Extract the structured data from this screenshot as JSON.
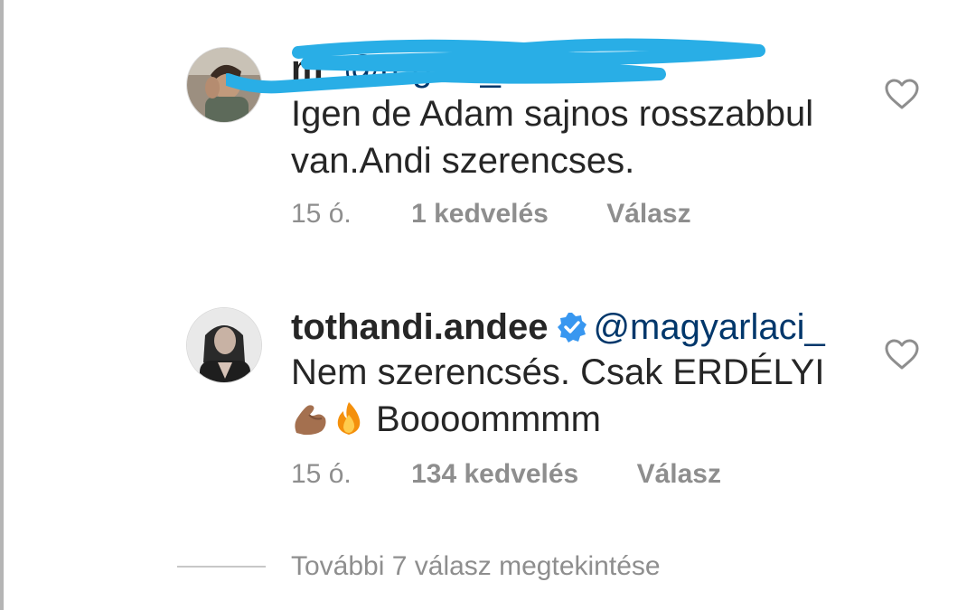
{
  "comments": [
    {
      "username_visible": "m",
      "mention": "_@regina_molnar",
      "line1": "Igen de Adam sajnos rosszabbul",
      "line2": "van.Andi szerencses.",
      "time": "15 ó.",
      "likes": "1 kedvelés",
      "reply": "Válasz",
      "avatar_icon": "profile-photo",
      "like_icon": "heart-outline-icon"
    },
    {
      "username": "tothandi.andee",
      "verified_icon": "verified-badge-icon",
      "mention": "@magyarlaci_",
      "line1": "Nem szerencsés. Csak ERDÉLYI",
      "line2": "Boooommmm",
      "emojis": [
        "flexed-biceps-emoji",
        "fire-emoji"
      ],
      "time": "15 ó.",
      "likes": "134 kedvelés",
      "reply": "Válasz",
      "avatar_icon": "profile-photo",
      "like_icon": "heart-outline-icon"
    }
  ],
  "view_more": "További 7 válasz megtekintése",
  "colors": {
    "text": "#262626",
    "secondary": "#8e8e8e",
    "mention": "#00376b",
    "verified": "#3897f0",
    "redaction": "#29aee6"
  }
}
